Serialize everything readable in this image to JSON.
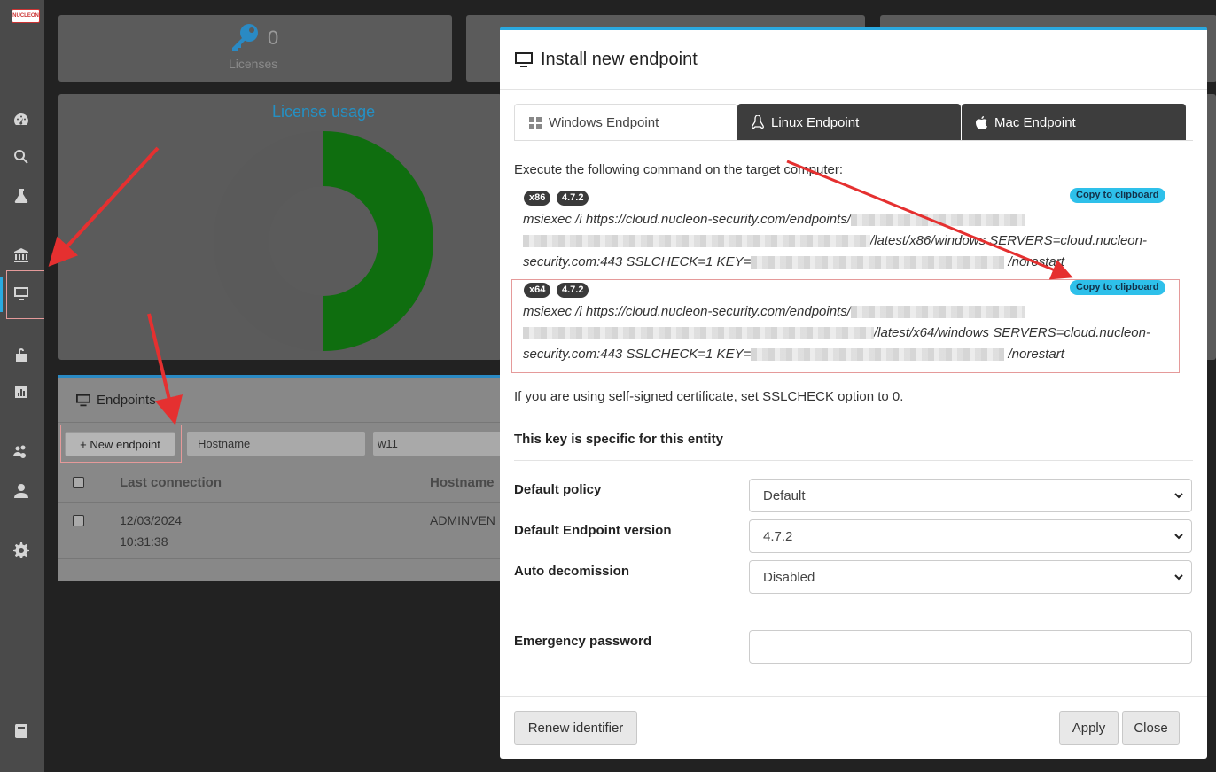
{
  "sidebar": {
    "logo_text": "NUCLEON",
    "icons": [
      "dashboard-icon",
      "search-icon",
      "flask-icon",
      "bank-icon",
      "monitor-icon",
      "unlock-icon",
      "chart-icon",
      "users-cog-icon",
      "user-icon",
      "gear-icon",
      "book-icon"
    ]
  },
  "dashboard": {
    "licenses_count": "0",
    "licenses_label": "Licenses",
    "license_usage_title": "License usage"
  },
  "endpoints": {
    "title": "Endpoints",
    "new_button": "+ New endpoint",
    "filter_select": "Hostname",
    "filter_value": "w11",
    "columns": [
      "Last connection",
      "Hostname"
    ],
    "rows": [
      {
        "last_connection_date": "12/03/2024",
        "last_connection_time": "10:31:38",
        "hostname": "ADMINVEN"
      }
    ]
  },
  "modal": {
    "title": "Install new endpoint",
    "tabs": [
      "Windows Endpoint",
      "Linux Endpoint",
      "Mac Endpoint"
    ],
    "instruction": "Execute the following command on the target computer:",
    "commands": [
      {
        "arch": "x86",
        "version": "4.7.2",
        "copy_label": "Copy to clipboard",
        "line1": "msiexec /i https://cloud.nucleon-security.com/endpoints/",
        "line2_suffix": "/latest/x86/windows SERVERS=cloud.nucleon-",
        "line3_prefix": "security.com:443 SSLCHECK=1 KEY=",
        "line3_suffix": "/norestart"
      },
      {
        "arch": "x64",
        "version": "4.7.2",
        "copy_label": "Copy to clipboard",
        "line1": "msiexec /i https://cloud.nucleon-security.com/endpoints/",
        "line2_suffix": "/latest/x64/windows SERVERS=cloud.nucleon-",
        "line3_prefix": "security.com:443 SSLCHECK=1 KEY=",
        "line3_suffix": "/norestart"
      }
    ],
    "ssl_note": "If you are using self-signed certificate, set SSLCHECK option to 0.",
    "key_note": "This key is specific for this entity",
    "fields": {
      "default_policy_label": "Default policy",
      "default_policy_value": "Default",
      "endpoint_version_label": "Default Endpoint version",
      "endpoint_version_value": "4.7.2",
      "auto_decom_label": "Auto decomission",
      "auto_decom_value": "Disabled",
      "emergency_label": "Emergency password",
      "emergency_value": ""
    },
    "buttons": {
      "renew": "Renew identifier",
      "apply": "Apply",
      "close": "Close"
    }
  },
  "colors": {
    "accent": "#2aa9e0",
    "chart_green": "#0f6e0f",
    "chart_gray": "#5a5a5a",
    "annotation_red": "#e53030"
  }
}
